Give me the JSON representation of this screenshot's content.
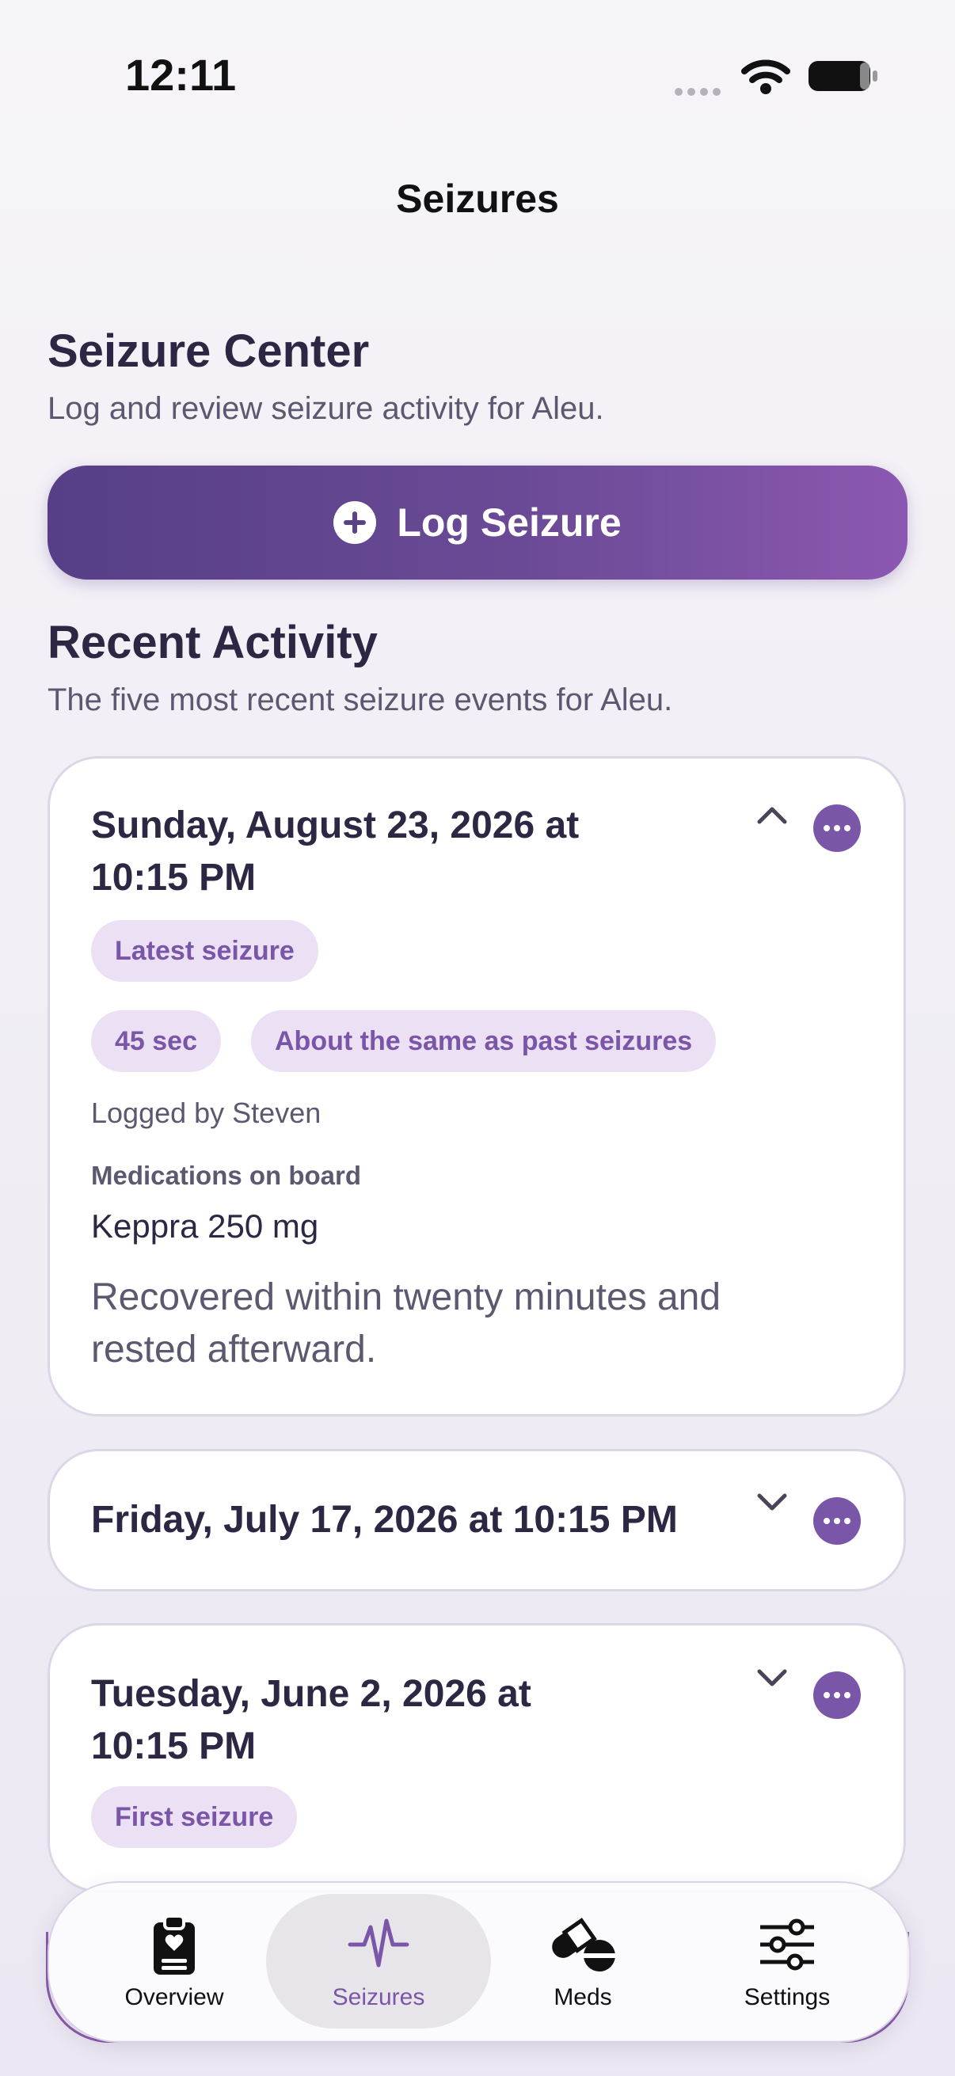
{
  "status_bar": {
    "time": "12:11"
  },
  "nav": {
    "title": "Seizures"
  },
  "header": {
    "title": "Seizure Center",
    "subtitle": "Log and review seizure activity for Aleu.",
    "log_button_label": "Log Seizure"
  },
  "recent": {
    "title": "Recent Activity",
    "subtitle": "The five most recent seizure events for Aleu.",
    "events": [
      {
        "date_line1": "Sunday, August 23, 2026 at",
        "date_line2": "10:15 PM",
        "tag": "Latest seizure",
        "duration": "45 sec",
        "comparison": "About the same as past seizures",
        "logged_by": "Logged by Steven",
        "meds_label": "Medications on board",
        "meds": "Keppra 250 mg",
        "notes_line1": "Recovered within twenty minutes and",
        "notes_line2": "rested afterward.",
        "expanded": true
      },
      {
        "date_line1": "Friday, July 17, 2026 at 10:15 PM",
        "expanded": false
      },
      {
        "date_line1": "Tuesday, June 2, 2026 at",
        "date_line2": "10:15 PM",
        "tag": "First seizure",
        "expanded": false
      }
    ]
  },
  "tabs": [
    {
      "label": "Overview",
      "icon": "clipboard-icon"
    },
    {
      "label": "Seizures",
      "icon": "waveform-icon",
      "active": true
    },
    {
      "label": "Meds",
      "icon": "pills-icon"
    },
    {
      "label": "Settings",
      "icon": "sliders-icon"
    }
  ],
  "colors": {
    "accent": "#7a56a8",
    "button_start": "#563f86",
    "button_end": "#8b58b1",
    "pill_bg": "#ebe0f4"
  }
}
